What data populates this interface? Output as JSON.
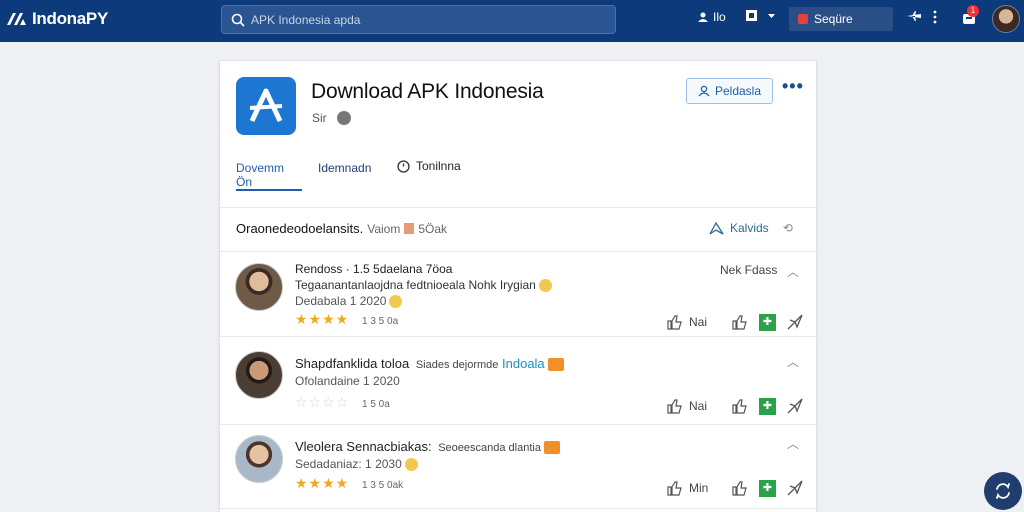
{
  "topbar": {
    "logo": "IndonaPY",
    "search_placeholder": "APK Indonesia apda",
    "item1_label": "Ilo",
    "secure_label": "Seqüre",
    "badge_count": "1",
    "colors": {
      "bar": "#0d3a7a",
      "search": "#2a5592",
      "badge": "#e33333"
    }
  },
  "app": {
    "title": "Download APK Indonesia",
    "subtitle": "Sir",
    "pedia_button": "Peldasla",
    "more": "•••",
    "icon": "apk-store-icon",
    "accent": "#1d76d1"
  },
  "tabs": [
    {
      "label": "Dovemm Ön"
    },
    {
      "label": "Idemnadn"
    },
    {
      "label": "Tonilnna"
    }
  ],
  "overview": {
    "title": "Oraonedeodoelansits.",
    "meta": "Vaiom",
    "count": "5Öak",
    "right_label": "Kalvids"
  },
  "reviews": [
    {
      "name": "Rendoss · 1.5 5daelana 7öoa",
      "line": "Tegaanantanlaojdna fedtnioeala Nohk Irygian",
      "meta": "Dedabala 1 2020",
      "stars": 4,
      "stars_text": "1 3 5 0a",
      "right": "Nek Fdass",
      "like_label": "Nai"
    },
    {
      "name": "Shapdfanklida toloa",
      "extra": "Siades dejormde",
      "flag": "Indoala",
      "meta": "Ofolandaine 1 2020",
      "stars": 0,
      "stars_text": "1 5 0a",
      "like_label": "Nai"
    },
    {
      "name": "Vleolera Sennacbiakas:",
      "extra": "Seoeescanda dlantia",
      "meta": "Sedadaniaz: 1 2030",
      "stars": 4,
      "stars_text": "1 3 5 0ak",
      "like_label": "Min"
    }
  ]
}
